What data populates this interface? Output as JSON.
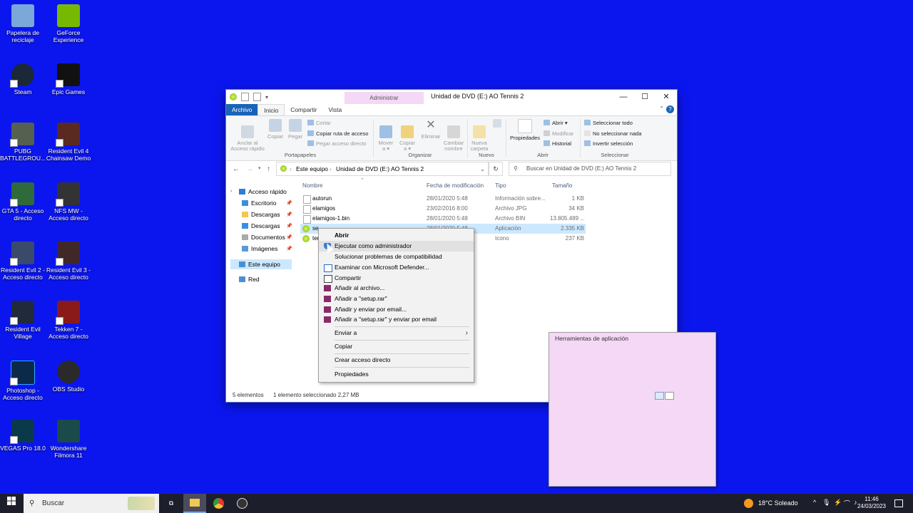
{
  "desktop": {
    "icons": [
      {
        "label": "Papelera de reciclaje",
        "icon": "recycle-bin-icon",
        "color": "#7aa8d8"
      },
      {
        "label": "GeForce Experience",
        "icon": "geforce-icon",
        "color": "#76b900"
      },
      {
        "label": "Steam",
        "icon": "steam-icon",
        "color": "#1b2838"
      },
      {
        "label": "Epic Games",
        "icon": "epic-games-icon",
        "color": "#111111"
      },
      {
        "label": "PUBG BATTLEGROU...",
        "icon": "pubg-icon",
        "color": "#556050"
      },
      {
        "label": "Resident Evil 4 Chainsaw Demo",
        "icon": "re4-icon",
        "color": "#5a2a20"
      },
      {
        "label": "GTA 5 - Acceso directo",
        "icon": "gta5-icon",
        "color": "#2f6b3a"
      },
      {
        "label": "NFS MW - Acceso directo",
        "icon": "nfs-icon",
        "color": "#333333"
      },
      {
        "label": "Resident Evil 2 - Acceso directo",
        "icon": "re2-icon",
        "color": "#3a4a6a"
      },
      {
        "label": "Resident Evil 3 - Acceso directo",
        "icon": "re3-icon",
        "color": "#402828"
      },
      {
        "label": "Resident Evil Village",
        "icon": "re-village-icon",
        "color": "#202a3a"
      },
      {
        "label": "Tekken 7 - Acceso directo",
        "icon": "tekken-icon",
        "color": "#8a1a1a"
      },
      {
        "label": "Photoshop - Acceso directo",
        "icon": "photoshop-icon",
        "color": "#0b2a4a"
      },
      {
        "label": "OBS Studio",
        "icon": "obs-icon",
        "color": "#2a2a2a"
      },
      {
        "label": "VEGAS Pro 18.0",
        "icon": "vegas-icon",
        "color": "#0a3a4a"
      },
      {
        "label": "Wondershare Filmora 11",
        "icon": "filmora-icon",
        "color": "#1a4a4a"
      }
    ]
  },
  "window": {
    "context_tab_header": "Administrar",
    "title": "Unidad de DVD (E:) AO Tennis 2",
    "tabs": [
      "Archivo",
      "Inicio",
      "Compartir",
      "Vista",
      "Herramientas de aplicación"
    ],
    "ribbon": {
      "pin": "Anclar al\nAcceso rápido",
      "copy": "Copiar",
      "paste": "Pegar",
      "cut": "Cortar",
      "copy_path": "Copiar ruta de acceso",
      "paste_shortcut": "Pegar acceso directo",
      "group_clipboard": "Portapapeles",
      "move_to": "Mover\na ▾",
      "copy_to": "Copiar\na ▾",
      "delete": "Eliminar",
      "rename": "Cambiar\nnombre",
      "group_organize": "Organizar",
      "new_folder": "Nueva\ncarpeta",
      "group_new": "Nuevo",
      "properties": "Propiedades",
      "open": "Abrir ▾",
      "modify": "Modificar",
      "history": "Historial",
      "group_open": "Abrir",
      "select_all": "Seleccionar todo",
      "select_none": "No seleccionar nada",
      "invert": "Invertir selección",
      "group_select": "Seleccionar"
    },
    "address": {
      "crumb1": "Este equipo",
      "crumb2": "Unidad de DVD (E:) AO Tennis 2",
      "search_placeholder": "Buscar en Unidad de DVD (E:) AO Tennis 2"
    },
    "navpane": [
      {
        "label": "Acceso rápido",
        "icon": "star-icon",
        "color": "#2a7fd8"
      },
      {
        "label": "Escritorio",
        "icon": "desktop-folder-icon",
        "color": "#3a8ee0"
      },
      {
        "label": "Descargas",
        "icon": "folder-icon",
        "color": "#f0c855"
      },
      {
        "label": "Descargas",
        "icon": "download-icon",
        "color": "#3a8ee0"
      },
      {
        "label": "Documentos",
        "icon": "documents-icon",
        "color": "#aaaaaa"
      },
      {
        "label": "Imágenes",
        "icon": "pictures-icon",
        "color": "#5a9ad8"
      },
      {
        "label": "Este equipo",
        "icon": "pc-icon",
        "color": "#4a90d0"
      },
      {
        "label": "Red",
        "icon": "network-icon",
        "color": "#4a90d0"
      }
    ],
    "columns": [
      "Nombre",
      "Fecha de modificación",
      "Tipo",
      "Tamaño"
    ],
    "files": [
      {
        "name": "autorun",
        "date": "28/01/2020 5:48",
        "type": "Información sobre...",
        "size": "1 KB"
      },
      {
        "name": "elamigos",
        "date": "23/02/2016 8:00",
        "type": "Archivo JPG",
        "size": "34 KB"
      },
      {
        "name": "elamigos-1.bin",
        "date": "28/01/2020 5:48",
        "type": "Archivo BIN",
        "size": "13.805.489 ..."
      },
      {
        "name": "setup",
        "date": "28/01/2020 5:48",
        "type": "Aplicación",
        "size": "2.335 KB"
      },
      {
        "name": "tennis",
        "date": "",
        "type": "Icono",
        "size": "237 KB"
      }
    ],
    "status": {
      "count": "5 elementos",
      "selected": "1 elemento seleccionado  2,27 MB"
    }
  },
  "context_menu": {
    "items": [
      {
        "label": "Abrir"
      },
      {
        "label": "Ejecutar como administrador",
        "icon": "shield-icon"
      },
      {
        "label": "Solucionar problemas de compatibilidad"
      },
      {
        "label": "Examinar con Microsoft Defender...",
        "icon": "defender-icon"
      },
      {
        "label": "Compartir",
        "icon": "share-icon"
      },
      {
        "label": "Añadir al archivo...",
        "icon": "winrar-icon"
      },
      {
        "label": "Añadir a \"setup.rar\"",
        "icon": "winrar-icon"
      },
      {
        "label": "Añadir y enviar por email...",
        "icon": "winrar-icon"
      },
      {
        "label": "Añadir a \"setup.rar\" y enviar por email",
        "icon": "winrar-icon"
      },
      {
        "label": "Enviar a"
      },
      {
        "label": "Copiar"
      },
      {
        "label": "Crear acceso directo"
      },
      {
        "label": "Propiedades"
      }
    ]
  },
  "taskbar": {
    "search_placeholder": "Buscar",
    "weather": "18°C  Soleado",
    "time": "11:46",
    "date": "24/03/2023"
  },
  "colors": {
    "desktop": "#0b16ef",
    "accent": "#1a64b8",
    "selection": "#cce8ff"
  }
}
